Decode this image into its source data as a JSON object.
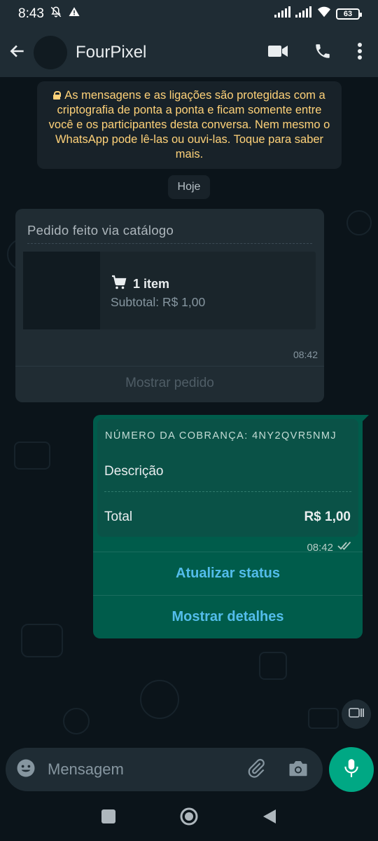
{
  "status_bar": {
    "time": "8:43",
    "battery": "63"
  },
  "header": {
    "contact_name": "FourPixel"
  },
  "encryption_notice": "As mensagens e as ligações são protegidas com a criptografia de ponta a ponta e ficam somente entre você e os participantes desta conversa. Nem mesmo o WhatsApp pode lê-las ou ouvi-las. Toque para saber mais.",
  "date_chip": "Hoje",
  "order_message": {
    "title": "Pedido feito via catálogo",
    "items": "1 item",
    "subtotal": "Subtotal: R$ 1,00",
    "time": "08:42",
    "action": "Mostrar pedido"
  },
  "payment_message": {
    "number": "NÚMERO DA COBRANÇA: 4NY2QVR5NMJ",
    "description": "Descrição",
    "total_label": "Total",
    "total_value": "R$ 1,00",
    "time": "08:42",
    "actions": [
      "Atualizar status",
      "Mostrar detalhes"
    ]
  },
  "composer": {
    "placeholder": "Mensagem"
  },
  "colors": {
    "background": "#0b141a",
    "header": "#1f2c34",
    "incoming_bubble": "#202c33",
    "outgoing_bubble": "#005c4b",
    "notice_text": "#ffd279",
    "link": "#53bdeb",
    "accent": "#00a884"
  },
  "icons": [
    "muted-bell-icon",
    "alert-icon",
    "signal-icon",
    "wifi-icon",
    "battery-icon",
    "back-arrow-icon",
    "video-call-icon",
    "phone-icon",
    "more-options-icon",
    "lock-icon",
    "cart-icon",
    "double-check-icon",
    "emoji-icon",
    "attach-icon",
    "camera-icon",
    "mic-icon",
    "scroll-icon",
    "nav-recents-icon",
    "nav-home-icon",
    "nav-back-icon"
  ]
}
